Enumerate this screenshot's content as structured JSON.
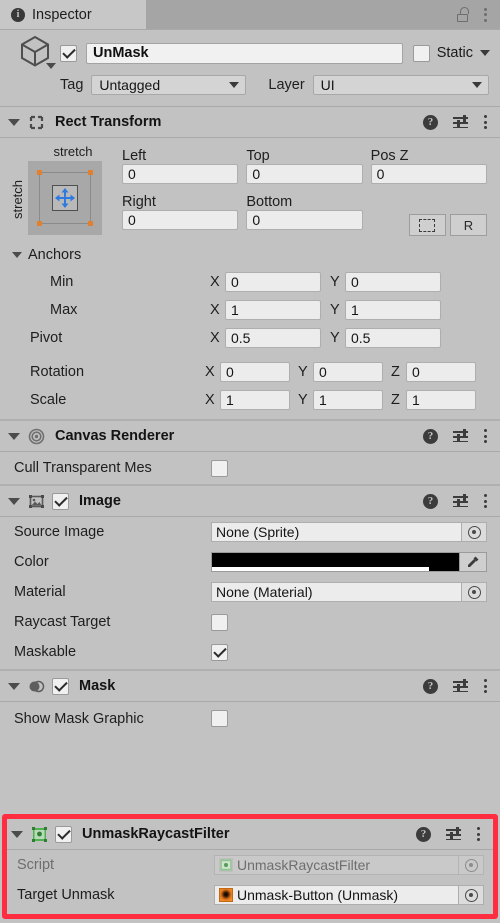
{
  "window": {
    "tab_label": "Inspector",
    "info_icon": "info-icon",
    "lock_icon": "lock-icon",
    "menu_icon": "kebab-menu-icon"
  },
  "gameobject": {
    "icon": "cube-icon",
    "enabled": true,
    "name": "UnMask",
    "static_label": "Static",
    "static_checked": false,
    "tag_label": "Tag",
    "tag_value": "Untagged",
    "layer_label": "Layer",
    "layer_value": "UI"
  },
  "components": [
    {
      "title": "Rect Transform",
      "icon": "rect-transform-icon",
      "has_checkbox": false,
      "expanded": true
    },
    {
      "title": "Canvas Renderer",
      "icon": "canvas-renderer-icon",
      "has_checkbox": false,
      "expanded": true
    },
    {
      "title": "Image",
      "icon": "image-icon",
      "has_checkbox": true,
      "checked": true,
      "expanded": true
    },
    {
      "title": "Mask",
      "icon": "mask-icon",
      "has_checkbox": true,
      "checked": true,
      "expanded": true
    },
    {
      "title": "UnmaskRaycastFilter",
      "icon": "script-icon",
      "has_checkbox": true,
      "checked": true,
      "expanded": true,
      "highlighted": true
    }
  ],
  "rect_transform": {
    "anchor_preset": {
      "top_label": "stretch",
      "side_label": "stretch"
    },
    "left_label": "Left",
    "left_value": "0",
    "top_label": "Top",
    "top_value": "0",
    "posz_label": "Pos Z",
    "posz_value": "0",
    "right_label": "Right",
    "right_value": "0",
    "bottom_label": "Bottom",
    "bottom_value": "0",
    "blueprint_button": "blueprint-mode-icon",
    "raw_button": "R",
    "anchors_label": "Anchors",
    "min_label": "Min",
    "min_x": "0",
    "min_y": "0",
    "max_label": "Max",
    "max_x": "1",
    "max_y": "1",
    "pivot_label": "Pivot",
    "pivot_x": "0.5",
    "pivot_y": "0.5",
    "rotation_label": "Rotation",
    "rotation_x": "0",
    "rotation_y": "0",
    "rotation_z": "0",
    "scale_label": "Scale",
    "scale_x": "1",
    "scale_y": "1",
    "scale_z": "1",
    "axis_x": "X",
    "axis_y": "Y",
    "axis_z": "Z"
  },
  "canvas_renderer": {
    "cull_label": "Cull Transparent Mes",
    "cull_checked": false
  },
  "image": {
    "source_image_label": "Source Image",
    "source_image_value": "None (Sprite)",
    "color_label": "Color",
    "color_value": "#000000",
    "color_alpha_pct": 88,
    "material_label": "Material",
    "material_value": "None (Material)",
    "raycast_target_label": "Raycast Target",
    "raycast_target_checked": false,
    "maskable_label": "Maskable",
    "maskable_checked": true
  },
  "mask": {
    "show_mask_graphic_label": "Show Mask Graphic",
    "show_mask_graphic_checked": false
  },
  "unmask_raycast_filter": {
    "script_label": "Script",
    "script_value": "UnmaskRaycastFilter",
    "target_unmask_label": "Target Unmask",
    "target_unmask_value": "Unmask-Button (Unmask)"
  },
  "colors": {
    "highlight": "#ff2d3f",
    "background": "#c2c2c2",
    "tab_inactive": "#a5a5a5",
    "accent_orange": "#e08030"
  }
}
